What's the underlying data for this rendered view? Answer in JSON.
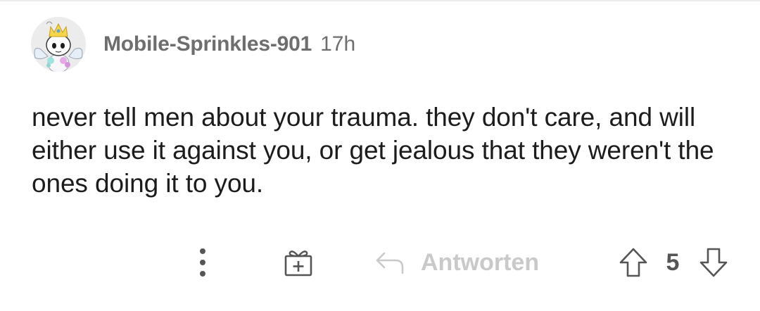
{
  "comment": {
    "author": "Mobile-Sprinkles-901",
    "timestamp": "17h",
    "body": "never tell men about your trauma. they don't care, and will either use it against you, or get jealous that they weren't the ones doing it to you."
  },
  "actions": {
    "more_icon": "more-vertical-icon",
    "award_icon": "gift-icon",
    "reply_icon": "reply-arrow-icon",
    "reply_label": "Antworten",
    "upvote_icon": "upvote-arrow-icon",
    "vote_count": "5",
    "downvote_icon": "downvote-arrow-icon"
  },
  "colors": {
    "text_primary": "#1c1c1c",
    "text_meta": "#6e6e6e",
    "action_icon": "#555555",
    "reply_disabled": "#c9c9c9",
    "avatar_background": "#ececec"
  }
}
